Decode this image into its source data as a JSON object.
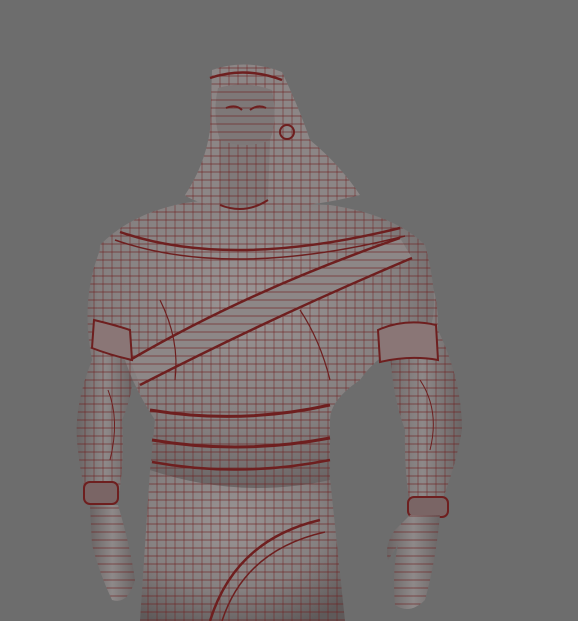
{
  "viewport": {
    "background": "#6d6d6d",
    "mesh_fill": "#8a8585",
    "mesh_shade": "#6f6a6a",
    "wire_color": "#6e1f1f",
    "wire_opacity": 0.85
  },
  "model": {
    "parts": [
      "head",
      "headdress",
      "beard",
      "neck",
      "torso",
      "left-arm",
      "right-arm",
      "left-bracelet",
      "right-bracelet",
      "left-hand",
      "right-hand",
      "sash",
      "belt",
      "robe"
    ]
  }
}
